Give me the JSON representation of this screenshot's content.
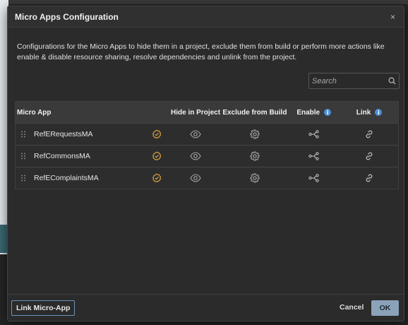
{
  "dialog": {
    "title": "Micro Apps Configuration",
    "close_glyph": "×",
    "description": "Configurations for the Micro Apps to hide them in a project, exclude them from build or perform more actions like enable & disable resource sharing, resolve dependencies and unlink from the project."
  },
  "search": {
    "placeholder": "Search",
    "value": ""
  },
  "table": {
    "headers": {
      "app": "Micro App",
      "hide": "Hide in Project",
      "exclude": "Exclude from Build",
      "enable": "Enable",
      "link": "Link"
    },
    "rows": [
      {
        "name": "RefERequestsMA"
      },
      {
        "name": "RefCommonsMA"
      },
      {
        "name": "RefEComplaintsMA"
      }
    ]
  },
  "footer": {
    "link_label": "Link Micro-App",
    "cancel_label": "Cancel",
    "ok_label": "OK"
  },
  "colors": {
    "status_icon": "#e0a63c",
    "icon_gray": "#a9a9a9",
    "info_blue": "#4b8fd6",
    "ok_button": "#8ba3b9"
  },
  "icons": {
    "status": "verified-check-icon",
    "hide": "eye-icon",
    "exclude": "gear-icon",
    "enable": "share-nodes-icon",
    "link": "link-icon",
    "drag": "drag-handle-icon",
    "search": "search-icon",
    "info": "info-icon"
  }
}
